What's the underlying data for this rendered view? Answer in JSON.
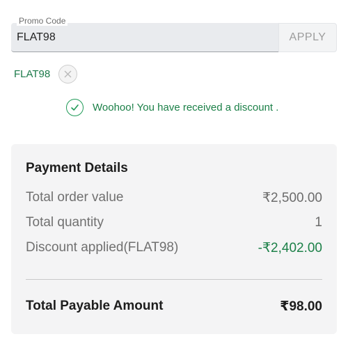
{
  "promo": {
    "label": "Promo Code",
    "value": "FLAT98",
    "apply_label": "APPLY"
  },
  "applied": {
    "code": "FLAT98",
    "remove_icon": "close-icon"
  },
  "success": {
    "icon": "check-circle-icon",
    "message": "Woohoo! You have received a discount ."
  },
  "payment": {
    "title": "Payment Details",
    "rows": [
      {
        "label": "Total order value",
        "value": "₹2,500.00"
      },
      {
        "label": "Total quantity",
        "value": "1"
      },
      {
        "label": "Discount applied(FLAT98)",
        "value": "-₹2,402.00"
      }
    ],
    "total_label": "Total Payable Amount",
    "total_value": "₹98.00"
  },
  "colors": {
    "accent_green": "#1c8048",
    "field_bg": "#e9ebee",
    "card_bg": "#f4f4f5"
  }
}
